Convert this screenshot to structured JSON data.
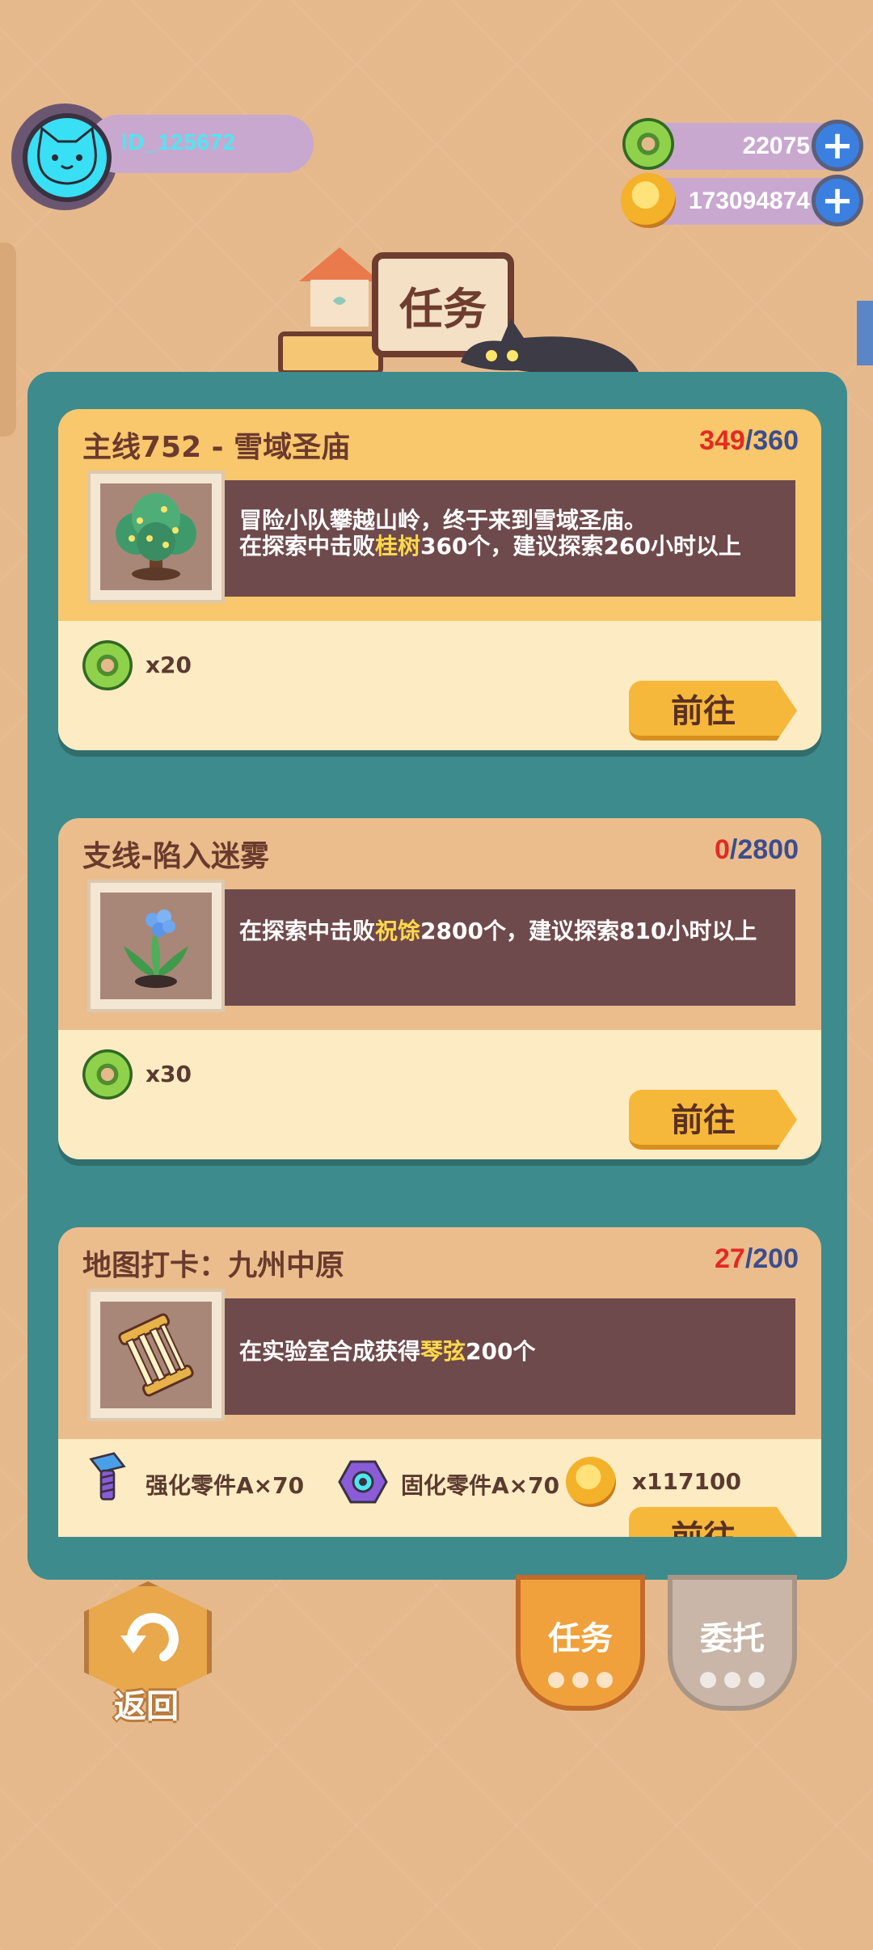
{
  "header": {
    "user_id": "ID_125672",
    "currency_1": {
      "icon": "green-donut-icon",
      "value": "22075"
    },
    "currency_2": {
      "icon": "gold-coin-icon",
      "value": "173094874"
    },
    "sign_title": "任务"
  },
  "tasks": [
    {
      "title": "主线752 - 雪域圣庙",
      "progress_current": "349",
      "progress_total": "/360",
      "desc_line1": "冒险小队攀越山岭，终于来到雪域圣庙。",
      "desc_pre": "在探索中击败",
      "desc_highlight": "桂树",
      "desc_post": "360个，建议探索260小时以上",
      "rewards": [
        {
          "icon": "green-donut-icon",
          "label": "x20"
        }
      ],
      "go_label": "前往"
    },
    {
      "title": "支线-陷入迷雾",
      "progress_current": "0",
      "progress_total": "/2800",
      "desc_pre": "在探索中击败",
      "desc_highlight": "祝馀",
      "desc_post": "2800个，建议探索810小时以上",
      "rewards": [
        {
          "icon": "green-donut-icon",
          "label": "x30"
        }
      ],
      "go_label": "前往"
    },
    {
      "title": "地图打卡：九州中原",
      "progress_current": "27",
      "progress_total": "/200",
      "desc_pre": "在实验室合成获得",
      "desc_highlight": "琴弦",
      "desc_post": "200个",
      "rewards": [
        {
          "icon": "purple-bolt-icon",
          "label": "强化零件A×70"
        },
        {
          "icon": "hex-nut-icon",
          "label": "固化零件A×70"
        },
        {
          "icon": "gold-coin-icon",
          "label": "x117100"
        }
      ],
      "go_label": "前往"
    }
  ],
  "nav": {
    "back_label": "返回",
    "tab_task": "任务",
    "tab_commission": "委托"
  },
  "colors": {
    "background": "#e6b98c",
    "panel": "#3d8b8d",
    "card_header_main": "#f9c76c",
    "card_header_side": "#ebbd8c",
    "progress_current": "#e22b22",
    "progress_total": "#3b4d8e",
    "highlight": "#ffd84a"
  }
}
